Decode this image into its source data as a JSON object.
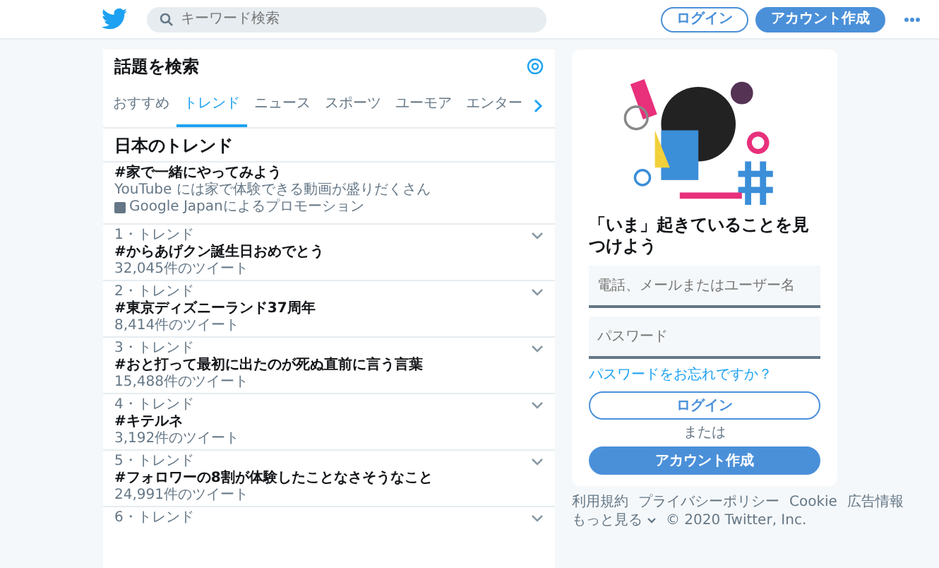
{
  "header": {
    "search": {
      "placeholder": "キーワード検索"
    },
    "buttons": [
      {
        "label": "ログイン",
        "kind": "outline"
      },
      {
        "label": "アカウント作成",
        "kind": "primary"
      }
    ]
  },
  "explore": {
    "title": "話題を検索",
    "tabs": [
      {
        "label": "おすすめ",
        "selected": false
      },
      {
        "label": "トレンド",
        "selected": true
      },
      {
        "label": "ニュース",
        "selected": false
      },
      {
        "label": "スポーツ",
        "selected": false
      },
      {
        "label": "ユーモア",
        "selected": false
      },
      {
        "label": "エンター",
        "selected": false
      }
    ],
    "section_title": "日本のトレンド",
    "promoted": {
      "title": "#家で一緒にやってみよう",
      "description": "YouTube には家で体験できる動画が盛りだくさん",
      "promoter": "Google Japanによるプロモーション"
    },
    "trends": [
      {
        "context": "1・トレンド",
        "title": "#からあげクン誕生日おめでとう",
        "count": "32,045件のツイート"
      },
      {
        "context": "2・トレンド",
        "title": "#東京ディズニーランド37周年",
        "count": "8,414件のツイート"
      },
      {
        "context": "3・トレンド",
        "title": "#おと打って最初に出たのが死ぬ直前に言う言葉",
        "count": "15,488件のツイート"
      },
      {
        "context": "4・トレンド",
        "title": "#キテルネ",
        "count": "3,192件のツイート"
      },
      {
        "context": "5・トレンド",
        "title": "#フォロワーの8割が体験したことなさそうなこと",
        "count": "24,991件のツイート"
      },
      {
        "context": "6・トレンド"
      }
    ]
  },
  "signup": {
    "heading": "「いま」起きていることを見つけよう",
    "fields": [
      {
        "placeholder": "電話、メールまたはユーザー名"
      },
      {
        "placeholder": "パスワード"
      }
    ],
    "forgot_link": "パスワードをお忘れですか？",
    "login_button": "ログイン",
    "separator": "または",
    "signup_button": "アカウント作成"
  },
  "footer": {
    "links": [
      "利用規約",
      "プライバシーポリシー",
      "Cookie",
      "広告情報"
    ],
    "more": "もっと見る",
    "copyright": "© 2020 Twitter, Inc."
  }
}
